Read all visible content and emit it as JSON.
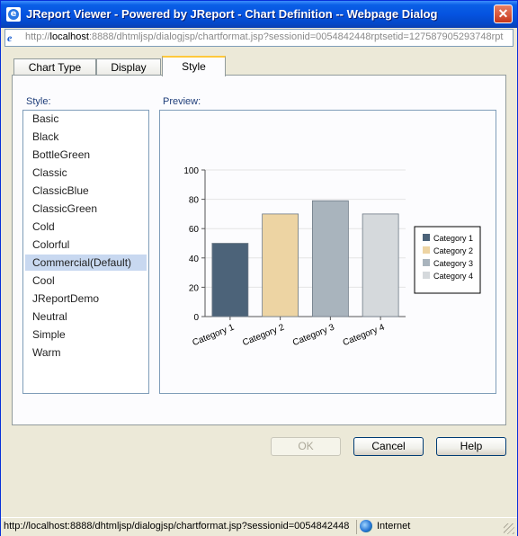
{
  "window": {
    "title": "JReport Viewer - Powered by JReport - Chart Definition -- Webpage Dialog",
    "close_label": "✕"
  },
  "address": {
    "prefix": "http://",
    "host": "localhost",
    "rest": ":8888/dhtmljsp/dialogjsp/chartformat.jsp?sessionid=0054842448rptsetid=127587905293748rpt"
  },
  "tabs": [
    {
      "label": "Chart Type"
    },
    {
      "label": "Display"
    },
    {
      "label": "Style"
    }
  ],
  "style_label": "Style:",
  "preview_label": "Preview:",
  "styles": [
    "Basic",
    "Black",
    "BottleGreen",
    "Classic",
    "ClassicBlue",
    "ClassicGreen",
    "Cold",
    "Colorful",
    "Commercial(Default)",
    "Cool",
    "JReportDemo",
    "Neutral",
    "Simple",
    "Warm"
  ],
  "selected_style": "Commercial(Default)",
  "buttons": {
    "ok": "OK",
    "cancel": "Cancel",
    "help": "Help"
  },
  "status": {
    "url": "http://localhost:8888/dhtmljsp/dialogjsp/chartformat.jsp?sessionid=0054842448",
    "zone": "Internet"
  },
  "chart_data": {
    "type": "bar",
    "categories": [
      "Category 1",
      "Category 2",
      "Category 3",
      "Category 4"
    ],
    "values": [
      50,
      70,
      79,
      70
    ],
    "ylim": [
      0,
      100
    ],
    "yticks": [
      "0",
      "20",
      "40",
      "60",
      "80",
      "100"
    ],
    "colors": [
      "#4c6379",
      "#edd4a3",
      "#a9b4bd",
      "#d5d9dc"
    ],
    "legend": [
      "Category 1",
      "Category 2",
      "Category 3",
      "Category 4"
    ],
    "legend_position": "right",
    "grid": true
  }
}
